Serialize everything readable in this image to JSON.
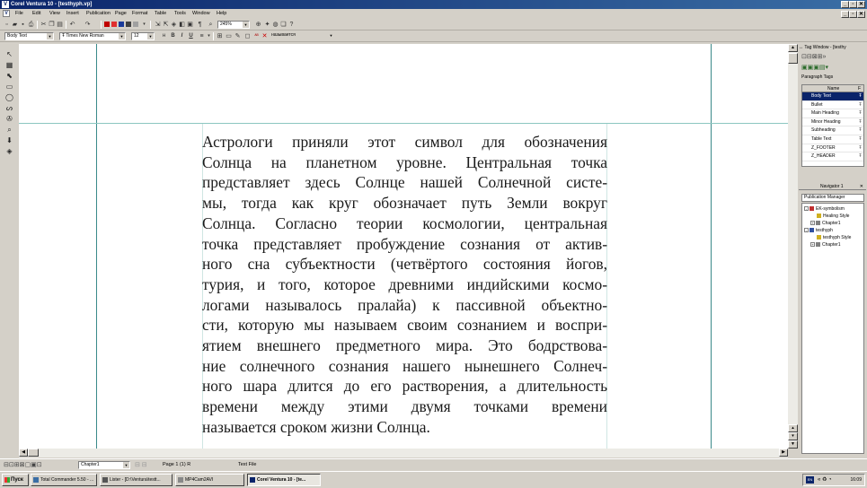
{
  "window": {
    "title": "Corel Ventura 10 - [testhyph.vp]",
    "controls": [
      "_",
      "▫",
      "✕"
    ],
    "doc_controls": [
      "_",
      "▫",
      "✕"
    ]
  },
  "menu": [
    "File",
    "Edit",
    "View",
    "Insert",
    "Publication",
    "Page",
    "Format",
    "Table",
    "Tools",
    "Window",
    "Help"
  ],
  "toolbar1": {
    "zoom": "245%"
  },
  "toolbar2": {
    "paragraph_tag": "Body Text",
    "font_name": "Times New Roman",
    "font_size": "12",
    "bold": "B",
    "italic": "I",
    "underline": "U",
    "spell_word": "называется"
  },
  "document": {
    "lines": [
      "Астрологи приняли этот символ для обозначения",
      "Солнца на планетном уровне. Центральная точка",
      "представляет здесь Солнце нашей Солнечной систе-",
      "мы, тогда как круг обозначает путь Земли вокруг",
      "Солнца. Согласно теории космологии, центральная",
      "точка представляет пробуждение сознания от актив-",
      "ного сна субъектности (четвёртого состояния йогов,",
      "турия, и того, которое древними индийскими космо-",
      "логами называлось пралайа) к пассивной объектно-",
      "сти, которую мы называем своим сознанием и воспри-",
      "ятием внешнего предметного мира. Это бодрствова-",
      "ние солнечного сознания нашего нынешнего Солнеч-",
      "ного шара длится до его растворения, а длительность",
      "времени между этими двумя точками времени",
      "называется сроком жизни Солнца."
    ],
    "colors": {
      "guide": "#a8d4d0",
      "margin": "#3a8a8a"
    }
  },
  "statusbar": {
    "chapter": "Chapter1",
    "page": "Page 1 (1)  R",
    "mode": "Text File"
  },
  "tag_window": {
    "title": "Tag Window - [testhy",
    "subtitle": "Paragraph Tags",
    "col_name": "Name",
    "col_f": "F",
    "tags": [
      "Body Text",
      "Bullet",
      "Main Heading",
      "Minor Heading",
      "Subheading",
      "Table Text",
      "Z_FOOTER",
      "Z_HEADER"
    ],
    "selected_index": 0
  },
  "navigator": {
    "title": "Navigator 1",
    "header": "Publication Manager",
    "nodes": [
      {
        "label": "EK-symbolism",
        "level": 0,
        "box": "-",
        "icon": "#c03030"
      },
      {
        "label": "Healing Style",
        "level": 2,
        "box": "",
        "icon": "#d0b020"
      },
      {
        "label": "Chapter1",
        "level": 1,
        "box": "+",
        "icon": "#808080"
      },
      {
        "label": "testhyph",
        "level": 0,
        "box": "-",
        "icon": "#3050a0"
      },
      {
        "label": "testhyph Style",
        "level": 2,
        "box": "",
        "icon": "#d0b020"
      },
      {
        "label": "Chapter1",
        "level": 1,
        "box": "+",
        "icon": "#808080"
      }
    ]
  },
  "taskbar": {
    "start": "Пуск",
    "tasks": [
      {
        "label": "Total Commander 5.50 - ...",
        "active": false
      },
      {
        "label": "Lister - [D:\\Ventura\\testt...",
        "active": false
      },
      {
        "label": "MP4Cam2AVI",
        "active": false
      },
      {
        "label": "Corel Ventura 10 - [te...",
        "active": true
      }
    ],
    "lang": "EN",
    "clock": "16:09"
  }
}
